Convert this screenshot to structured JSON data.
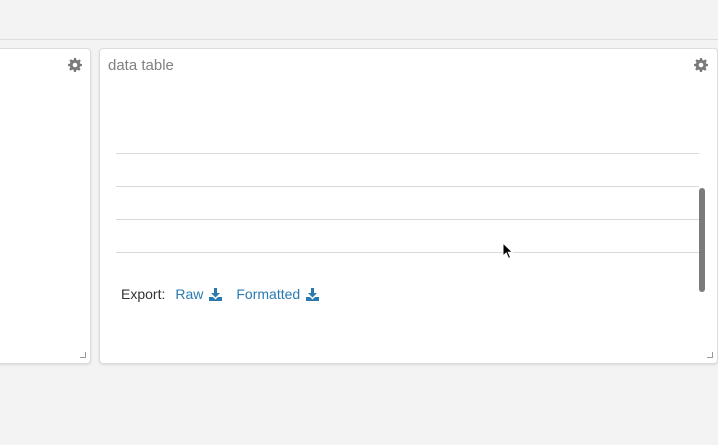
{
  "data_panel": {
    "title": "data table",
    "export": {
      "label": "Export:",
      "raw_label": "Raw",
      "formatted_label": "Formatted"
    }
  },
  "icons": {
    "settings": "gear-icon",
    "download": "download-icon",
    "resize": "resize-handle-icon",
    "pointer": "mouse-cursor-icon"
  },
  "colors": {
    "background": "#f3f3f3",
    "panel": "#ffffff",
    "link": "#2a7ab0",
    "muted_text": "#808080",
    "icon": "#7a7a7a"
  }
}
